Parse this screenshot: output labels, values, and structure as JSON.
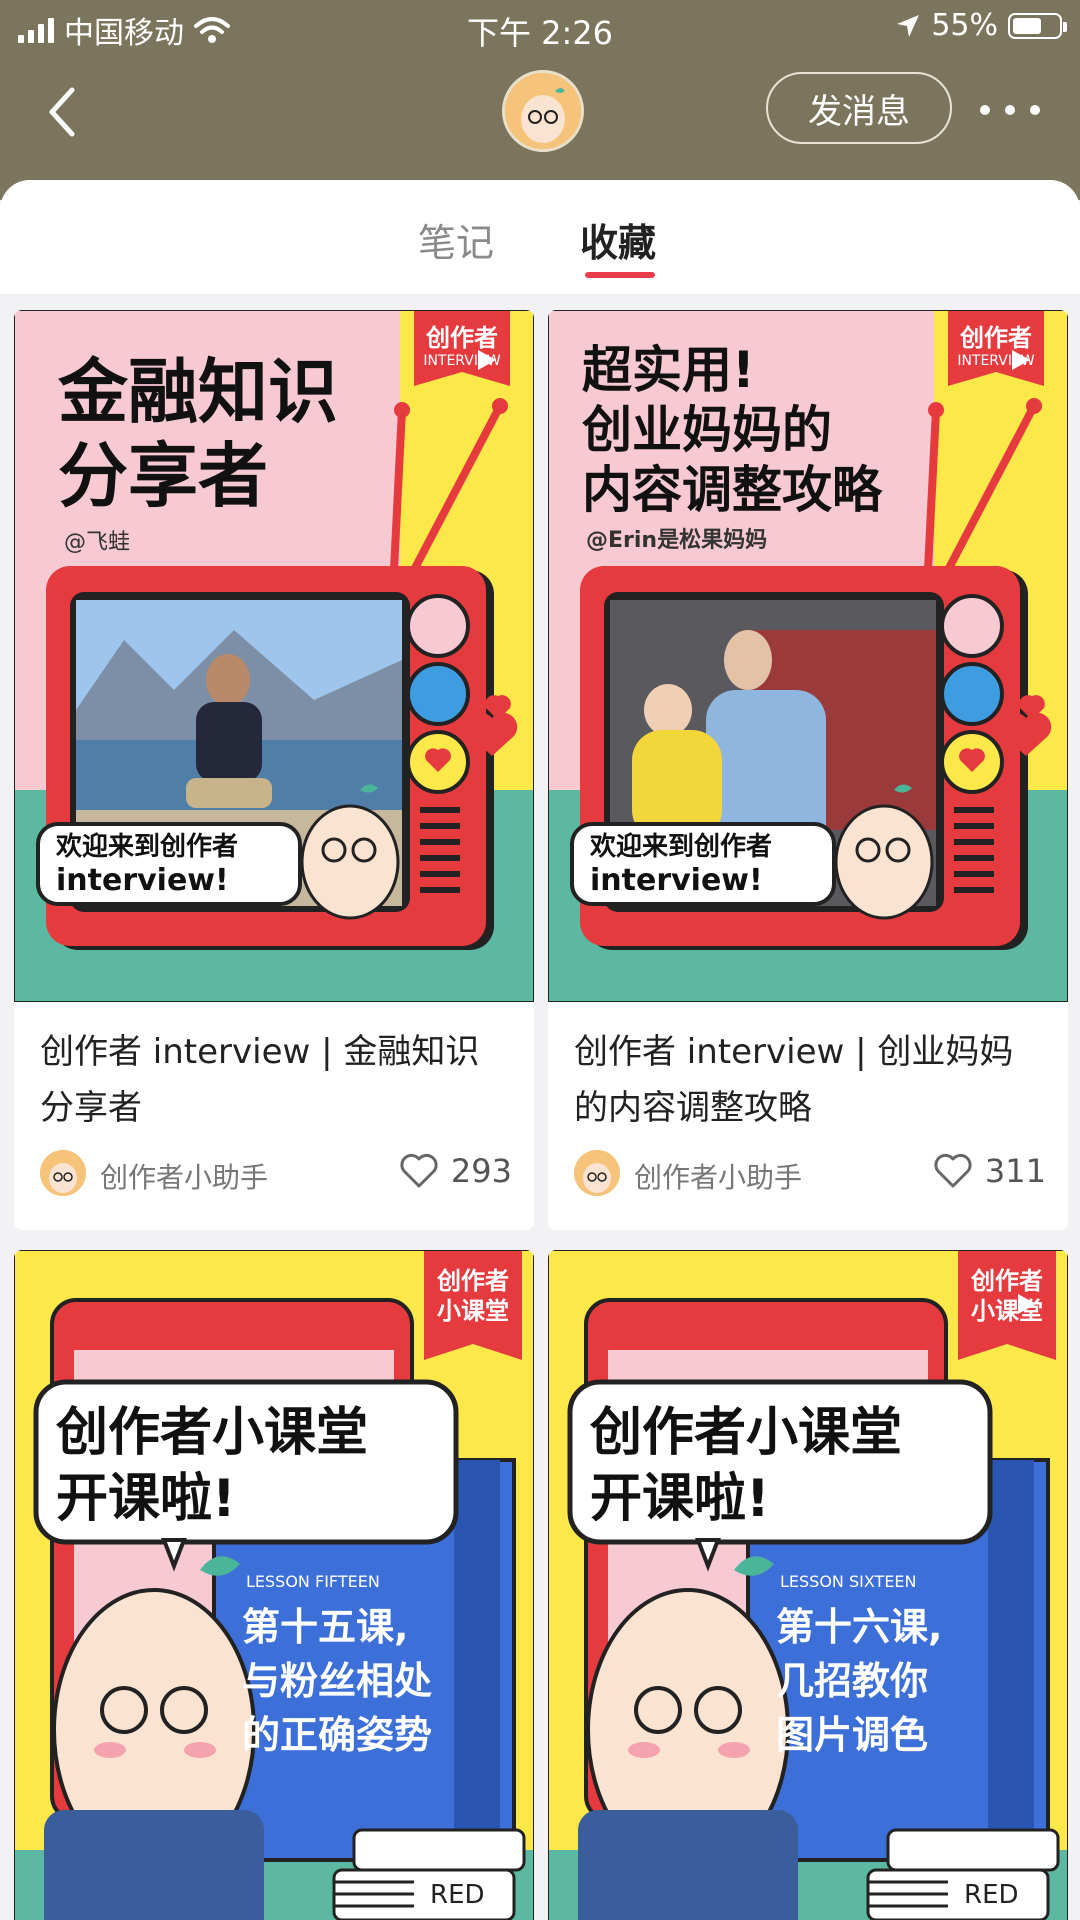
{
  "status_bar": {
    "carrier": "中国移动",
    "time": "下午 2:26",
    "battery": "55%"
  },
  "header": {
    "message_button": "发消息"
  },
  "tabs": [
    {
      "label": "笔记"
    },
    {
      "label": "收藏"
    }
  ],
  "cards": [
    {
      "cover_heading_line1": "金融知识",
      "cover_heading_line2": "分享者",
      "cover_handle": "@飞蛙",
      "badge_line1": "创作者",
      "badge_line2": "INTERVIEW",
      "bubble_line1": "欢迎来到创作者",
      "bubble_line2": "interview!",
      "title": "创作者 interview | 金融知识分享者",
      "author": "创作者小助手",
      "likes": "293"
    },
    {
      "cover_heading_line1": "超实用!",
      "cover_heading_line2": "创业妈妈的",
      "cover_heading_line3": "内容调整攻略",
      "cover_handle": "@Erin是松果妈妈",
      "badge_line1": "创作者",
      "badge_line2": "INTERVIEW",
      "bubble_line1": "欢迎来到创作者",
      "bubble_line2": "interview!",
      "title": "创作者 interview | 创业妈妈的内容调整攻略",
      "author": "创作者小助手",
      "likes": "311"
    },
    {
      "badge_line1": "创作者",
      "badge_line2": "小课堂",
      "bubble_line1": "创作者小课堂",
      "bubble_line2": "开课啦!",
      "lesson_en": "LESSON FIFTEEN",
      "lesson_line1": "第十五课,",
      "lesson_line2": "与粉丝相处",
      "lesson_line3": "的正确姿势",
      "book_label": "RED"
    },
    {
      "badge_line1": "创作者",
      "badge_line2": "小课堂",
      "bubble_line1": "创作者小课堂",
      "bubble_line2": "开课啦!",
      "lesson_en": "LESSON SIXTEEN",
      "lesson_line1": "第十六课,",
      "lesson_line2": "几招教你",
      "lesson_line3": "图片调色",
      "book_label": "RED"
    }
  ],
  "colors": {
    "header_bg": "#7b755d",
    "accent": "#e93c4b",
    "cover_pink": "#f7c9d3",
    "cover_yellow": "#fde84a",
    "cover_teal": "#5cb8a0",
    "cover_red": "#e53b3f",
    "cover_blue": "#3d6fd8"
  }
}
